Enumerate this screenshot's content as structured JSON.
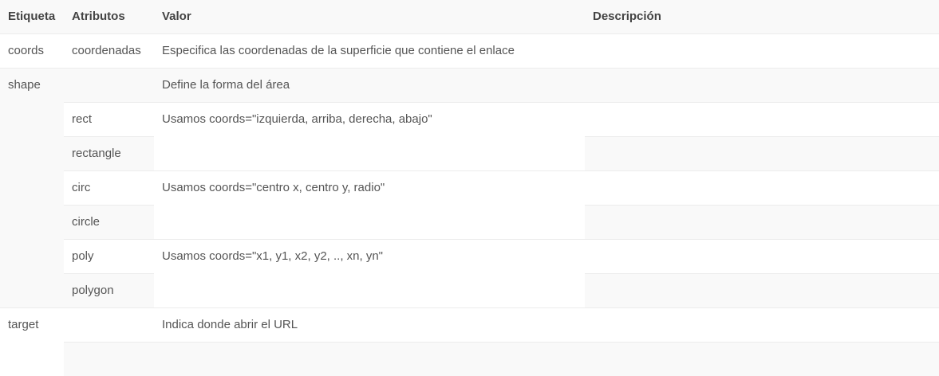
{
  "headers": [
    "Etiqueta",
    "Atributos",
    "Valor",
    "Descripción"
  ],
  "rows": {
    "coords": {
      "tag": "coords",
      "attr": "coordenadas",
      "value": "Especifica las coordenadas de la superficie que contiene el enlace"
    },
    "shape": {
      "tag": "shape",
      "value": "Define la forma del área",
      "options": [
        {
          "attrs": [
            "rect",
            "rectangle"
          ],
          "value": "Usamos coords=\"izquierda, arriba, derecha, abajo\""
        },
        {
          "attrs": [
            "circ",
            "circle"
          ],
          "value": "Usamos coords=\"centro x, centro y, radio\""
        },
        {
          "attrs": [
            "poly",
            "polygon"
          ],
          "value": "Usamos coords=\"x1, y1, x2, y2, .., xn, yn\""
        }
      ]
    },
    "target": {
      "tag": "target",
      "value": "Indica donde abrir el URL"
    }
  },
  "colors": {
    "stripe": "#f9f9f9",
    "text": "#555555",
    "border": "#ececec"
  }
}
